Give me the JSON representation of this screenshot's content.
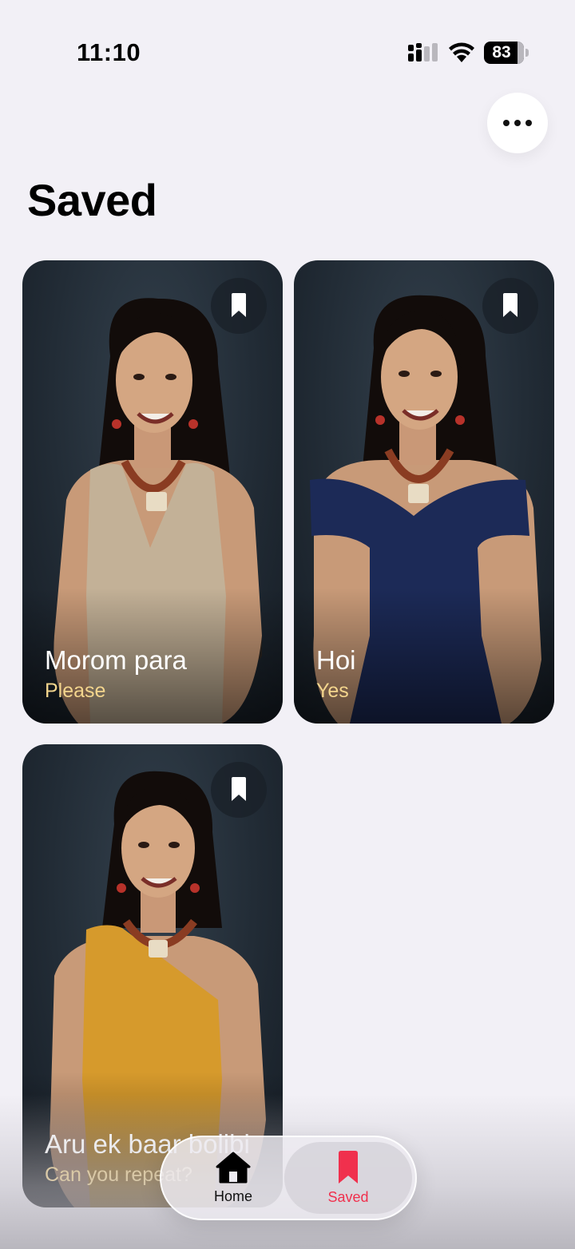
{
  "status_bar": {
    "time": "11:10",
    "battery": "83"
  },
  "page": {
    "title": "Saved"
  },
  "cards": [
    {
      "title": "Morom para",
      "subtitle": "Please",
      "outfit": "#c3b197"
    },
    {
      "title": "Hoi",
      "subtitle": "Yes",
      "outfit": "#1c2a57"
    },
    {
      "title": "Aru ek baar bolibi",
      "subtitle": "Can you repeat?",
      "outfit": "#d69a2c"
    }
  ],
  "tab_bar": {
    "home_label": "Home",
    "saved_label": "Saved",
    "active": "Saved"
  },
  "colors": {
    "accent": "#f0304d",
    "subtitle": "#f3d58d",
    "background": "#f2f0f6"
  }
}
